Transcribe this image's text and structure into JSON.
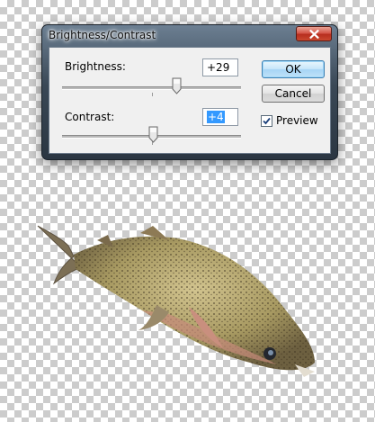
{
  "dialog": {
    "title": "Brightness/Contrast",
    "close_icon": "close-icon",
    "brightness": {
      "label": "Brightness:",
      "value": "+29"
    },
    "contrast": {
      "label": "Contrast:",
      "value": "+4"
    },
    "ok_label": "OK",
    "cancel_label": "Cancel",
    "preview": {
      "label": "Preview",
      "checked": true
    }
  },
  "canvas": {
    "background": "transparency-checkerboard",
    "image": "fish-photo"
  },
  "colors": {
    "titlebar": "#3a4856",
    "close_button": "#c8482f",
    "ok_button": "#bfe2f8",
    "selection": "#3399ff"
  }
}
